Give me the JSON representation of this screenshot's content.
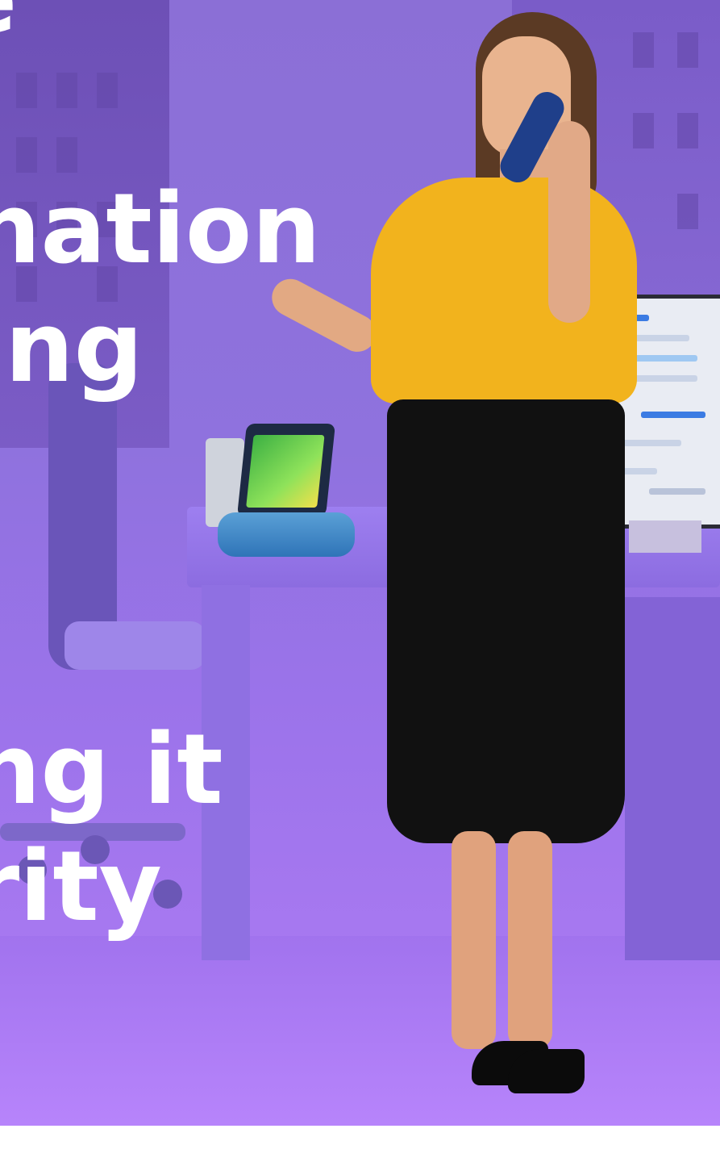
{
  "headline": {
    "line0": "e",
    "line1": "nation",
    "line2": "ing",
    "line3": "ng it",
    "line4": "rity"
  },
  "colors": {
    "background_top": "#8b6fd6",
    "background_bottom": "#b07cf5",
    "headline_text": "#ffffff",
    "shirt": "#f2b31d",
    "skirt": "#111111",
    "handset": "#1f3f8a"
  }
}
